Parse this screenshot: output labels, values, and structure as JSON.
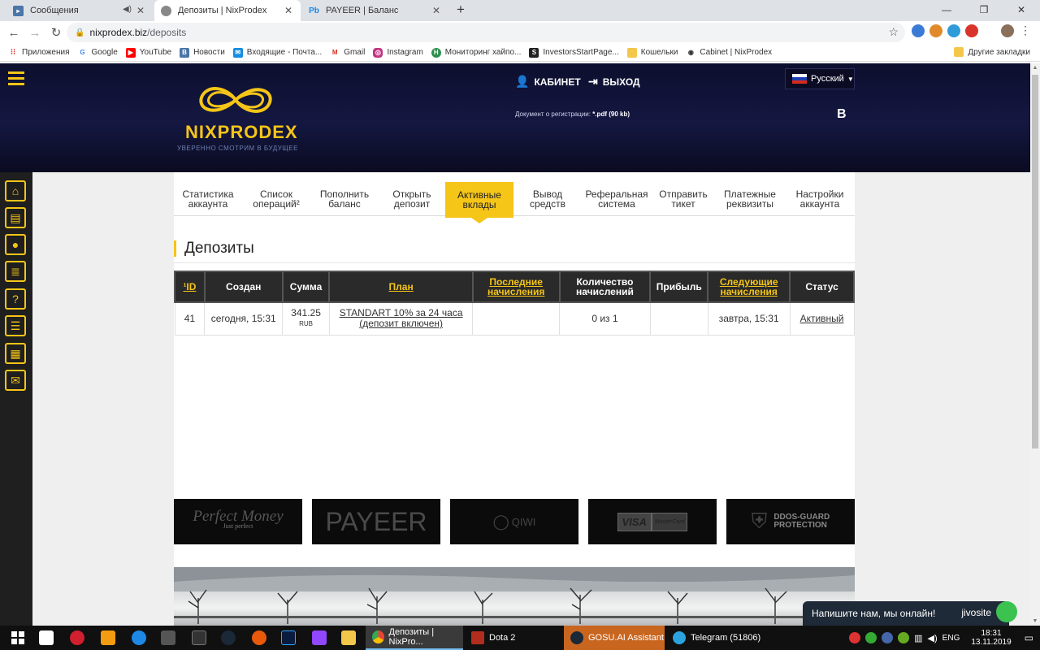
{
  "browser": {
    "tabs": [
      {
        "title": "Сообщения",
        "active": false
      },
      {
        "title": "Депозиты | NixProdex",
        "active": true
      },
      {
        "title": "PAYEER | Баланс",
        "active": false
      }
    ],
    "url_host": "nixprodex.biz",
    "url_path": "/deposits",
    "bookmarks": [
      "Приложения",
      "Google",
      "YouTube",
      "Новости",
      "Входящие - Почта...",
      "Gmail",
      "Instagram",
      "Мониторинг хайпо...",
      "InvestorsStartPage...",
      "Кошельки",
      "Cabinet | NixProdex"
    ],
    "other_bookmarks": "Другие закладки"
  },
  "header": {
    "logo_text": "NIXPRODEX",
    "slogan": "УВЕРЕННО СМОТРИМ В БУДУЩЕЕ",
    "cabinet": "КАБИНЕТ",
    "logout": "ВЫХОД",
    "language": "Русский",
    "reg_doc_label": "Документ о регистрации:",
    "reg_doc_value": "*.pdf (90 kb)",
    "b_letter": "B"
  },
  "subnav": [
    {
      "line1": "Статистика",
      "line2": "аккаунта"
    },
    {
      "line1": "Список",
      "line2": "операций²"
    },
    {
      "line1": "Пополнить",
      "line2": "баланс"
    },
    {
      "line1": "Открыть",
      "line2": "депозит"
    },
    {
      "line1": "Активные",
      "line2": "вклады"
    },
    {
      "line1": "Вывод",
      "line2": "средств"
    },
    {
      "line1": "Реферальная",
      "line2": "система"
    },
    {
      "line1": "Отправить",
      "line2": "тикет"
    },
    {
      "line1": "Платежные",
      "line2": "реквизиты"
    },
    {
      "line1": "Настройки",
      "line2": "аккаунта"
    }
  ],
  "section_title": "Депозиты",
  "table": {
    "headers": [
      "¹ID",
      "Создан",
      "Сумма",
      "План",
      "Последние начисления",
      "Количество начислений",
      "Прибыль",
      "Следующие начисления",
      "Статус"
    ],
    "row": {
      "id": "41",
      "created": "сегодня, 15:31",
      "amount": "341.25",
      "currency": "RUB",
      "plan_line1": "STANDART 10% за 24 часа",
      "plan_line2": "(депозит включен)",
      "last": "",
      "count": "0 из 1",
      "profit": "",
      "next": "завтра, 15:31",
      "status": "Активный"
    }
  },
  "payments": [
    "Perfect Money",
    "Just perfect",
    "PAYEER",
    "QIWI",
    "VISA",
    "MasterCard",
    "DDOS-GUARD",
    "PROTECTION"
  ],
  "chat": {
    "text": "Напишите нам, мы онлайн!",
    "brand": "jivosite"
  },
  "taskbar": {
    "apps": [
      "Депозиты | NixPro...",
      "Dota 2",
      "GOSU.AI Assistant",
      "Telegram (51806)"
    ],
    "lang": "ENG",
    "time": "18:31",
    "date": "13.11.2019"
  }
}
